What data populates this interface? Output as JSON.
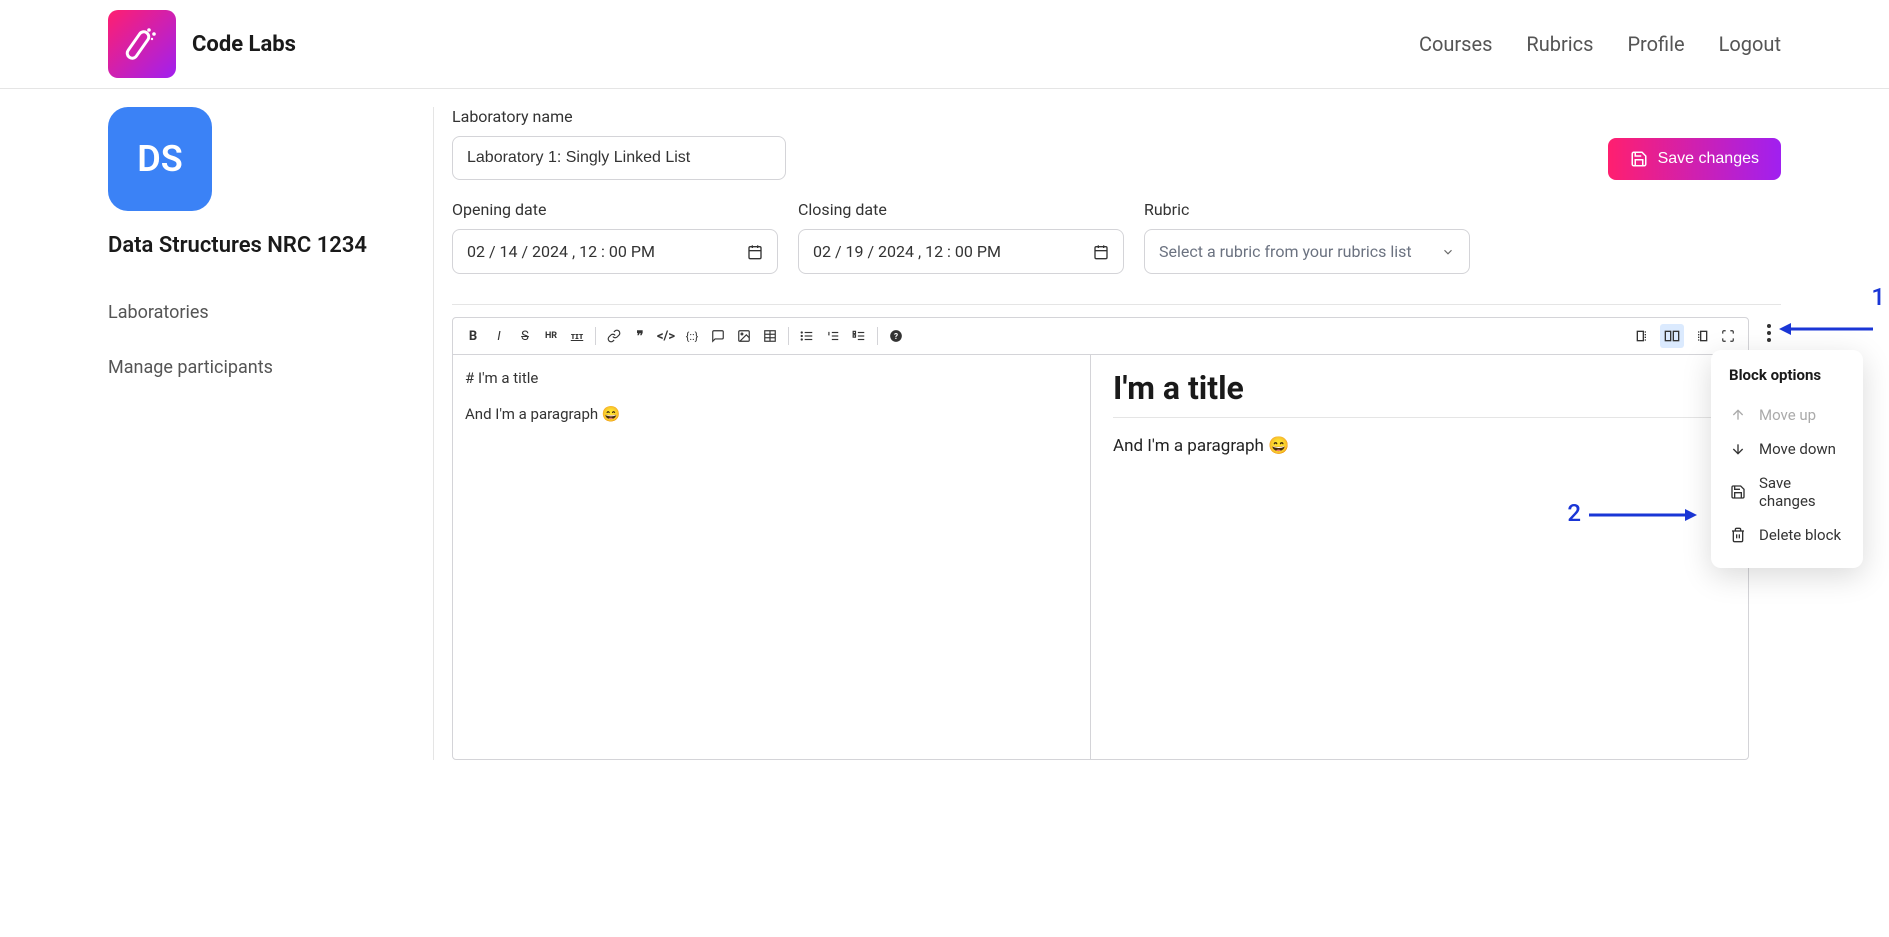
{
  "brand": "Code Labs",
  "nav": {
    "courses": "Courses",
    "rubrics": "Rubrics",
    "profile": "Profile",
    "logout": "Logout"
  },
  "sidebar": {
    "avatar_initials": "DS",
    "course_title": "Data Structures NRC 1234",
    "links": {
      "laboratories": "Laboratories",
      "manage_participants": "Manage participants"
    }
  },
  "form": {
    "lab_name_label": "Laboratory name",
    "lab_name_value": "Laboratory 1: Singly Linked List",
    "save_button": "Save changes",
    "opening_label": "Opening date",
    "opening_value": "02 / 14 / 2024 ,  12 : 00   PM",
    "closing_label": "Closing date",
    "closing_value": "02 / 19 / 2024 ,  12 : 00   PM",
    "rubric_label": "Rubric",
    "rubric_placeholder": "Select a rubric from your rubrics list"
  },
  "editor": {
    "source_line1": "# I'm a title",
    "source_line2": "And I'm a paragraph 😄",
    "preview_title": "I'm a title",
    "preview_paragraph": "And I'm a paragraph 😄"
  },
  "popup": {
    "title": "Block options",
    "move_up": "Move up",
    "move_down": "Move down",
    "save_changes": "Save changes",
    "delete_block": "Delete block"
  },
  "annotations": {
    "label1": "1",
    "label2": "2"
  }
}
